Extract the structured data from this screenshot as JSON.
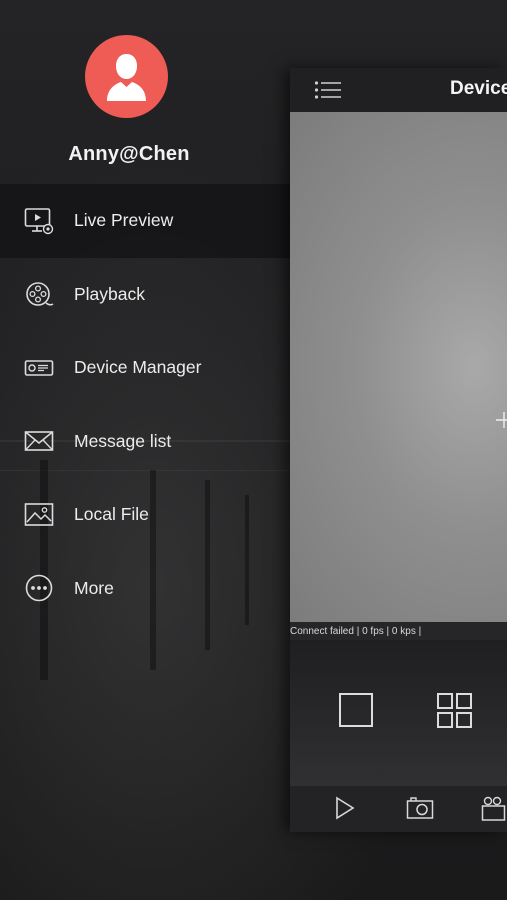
{
  "profile": {
    "username": "Anny@Chen"
  },
  "menu": {
    "items": [
      {
        "label": "Live Preview",
        "icon": "live-preview-icon",
        "active": true
      },
      {
        "label": "Playback",
        "icon": "playback-reel-icon",
        "active": false
      },
      {
        "label": "Device Manager",
        "icon": "device-manager-icon",
        "active": false
      },
      {
        "label": "Message list",
        "icon": "envelope-icon",
        "active": false
      },
      {
        "label": "Local File",
        "icon": "image-icon",
        "active": false
      },
      {
        "label": "More",
        "icon": "more-dots-icon",
        "active": false
      }
    ]
  },
  "panel": {
    "title": "Device",
    "status": "Connect failed | 0 fps | 0 kps |"
  },
  "colors": {
    "avatar": "#ef5b55",
    "background": "#1d1d1f",
    "text": "#ececec"
  }
}
